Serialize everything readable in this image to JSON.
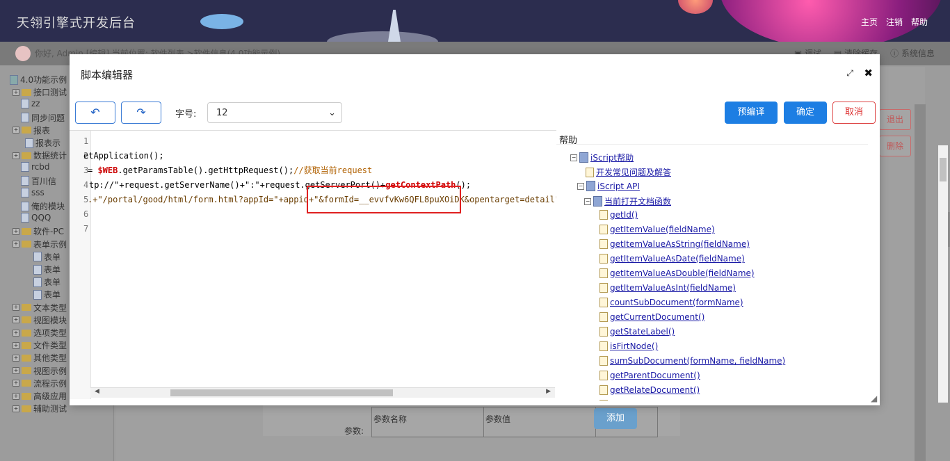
{
  "header": {
    "app_title": "天翎引擎式开发后台",
    "nav": [
      "主页",
      "注销",
      "帮助"
    ]
  },
  "subbar": {
    "greeting": "你好, Admin [编辑]   当前位置: 软件列表 >软件信息(4.0功能示例)",
    "tools": [
      "调试",
      "清除缓存",
      "系统信息"
    ]
  },
  "left_tree": {
    "items": [
      {
        "label": "4.0功能示例",
        "icon": "db"
      },
      {
        "label": "接口测试",
        "icon": "folder"
      },
      {
        "label": "zz",
        "icon": "doc"
      },
      {
        "label": "同步问题",
        "icon": "doc"
      },
      {
        "label": "报表",
        "icon": "folder"
      },
      {
        "label": "报表示",
        "icon": "doc"
      },
      {
        "label": "数据统计",
        "icon": "folder"
      },
      {
        "label": "rcbd",
        "icon": "doc"
      },
      {
        "label": "百川信",
        "icon": "doc"
      },
      {
        "label": "sss",
        "icon": "doc"
      },
      {
        "label": "俺的模块",
        "icon": "doc"
      },
      {
        "label": "QQQ",
        "icon": "doc"
      },
      {
        "label": "软件-PC",
        "icon": "folder"
      },
      {
        "label": "表单示例",
        "icon": "folder"
      },
      {
        "label": "表单",
        "icon": "doc"
      },
      {
        "label": "表单",
        "icon": "doc"
      },
      {
        "label": "表单",
        "icon": "doc"
      },
      {
        "label": "表单",
        "icon": "doc"
      },
      {
        "label": "文本类型",
        "icon": "folder"
      },
      {
        "label": "视图模块",
        "icon": "folder"
      },
      {
        "label": "选项类型",
        "icon": "folder"
      },
      {
        "label": "文件类型",
        "icon": "folder"
      },
      {
        "label": "其他类型",
        "icon": "folder"
      },
      {
        "label": "视图示例",
        "icon": "folder"
      },
      {
        "label": "流程示例",
        "icon": "folder"
      },
      {
        "label": "高级应用",
        "icon": "folder"
      },
      {
        "label": "辅助测试",
        "icon": "folder"
      }
    ]
  },
  "background": {
    "exit_label": "退出",
    "delete_label": "删除",
    "param_name_header": "参数名称",
    "param_value_header": "参数值",
    "add_label": "添加",
    "params_label": "参数:"
  },
  "modal": {
    "title": "脚本编辑器",
    "font_label": "字号:",
    "font_size": "12",
    "precompile_label": "预编译",
    "ok_label": "确定",
    "cancel_label": "取消",
    "line_numbers": [
      "1",
      "2",
      "3",
      "4",
      "5",
      "6",
      "7"
    ],
    "code": {
      "l2": "etApplication();",
      "l3a": "= ",
      "l3b": "$WEB",
      "l3c": ".getParamsTable().getHttpRequest();",
      "l3d": "//获取当前request",
      "l4a": "tp://",
      "l4b": "\"+request.getServerName()+\":\"+request.getServerPort()+",
      "l4c": "getContextPath",
      "l4d": "();",
      "l5a": ".+\"/portal/good/html/form.html?appId=\"+appid+\"&formId=__evvfvKw6QFL8puXOiDK&opentarget=detail\";"
    },
    "help_title": "帮助",
    "help_items": [
      {
        "label": "iScript帮助",
        "level": 0,
        "type": "book",
        "link": true
      },
      {
        "label": "开发常见问题及解答",
        "level": 1,
        "type": "page",
        "link": true
      },
      {
        "label": "iScript API",
        "level": 1,
        "type": "book",
        "link": true
      },
      {
        "label": "当前打开文档函数",
        "level": 2,
        "type": "book",
        "link": true
      },
      {
        "label": "getId()",
        "level": 3,
        "type": "page",
        "link": true
      },
      {
        "label": "getItemValue(fieldName)",
        "level": 3,
        "type": "page",
        "link": true
      },
      {
        "label": "getItemValueAsString(fieldName)",
        "level": 3,
        "type": "page",
        "link": true
      },
      {
        "label": "getItemValueAsDate(fieldName)",
        "level": 3,
        "type": "page",
        "link": true
      },
      {
        "label": "getItemValueAsDouble(fieldName)",
        "level": 3,
        "type": "page",
        "link": true
      },
      {
        "label": "getItemValueAsInt(fieldName)",
        "level": 3,
        "type": "page",
        "link": true
      },
      {
        "label": "countSubDocument(formName)",
        "level": 3,
        "type": "page",
        "link": true
      },
      {
        "label": "getCurrentDocument()",
        "level": 3,
        "type": "page",
        "link": true
      },
      {
        "label": "getStateLabel()",
        "level": 3,
        "type": "page",
        "link": true
      },
      {
        "label": "isFirtNode()",
        "level": 3,
        "type": "page",
        "link": true
      },
      {
        "label": "sumSubDocument(formName, fieldName)",
        "level": 3,
        "type": "page",
        "link": true
      },
      {
        "label": "getParentDocument()",
        "level": 3,
        "type": "page",
        "link": true
      },
      {
        "label": "getRelateDocument()",
        "level": 3,
        "type": "page",
        "link": true
      },
      {
        "label": "isComplete()",
        "level": 3,
        "type": "page",
        "link": true
      }
    ]
  },
  "colors": {
    "primary": "#1d7ee3",
    "danger": "#d33333",
    "highlight_box": "#e02020"
  }
}
